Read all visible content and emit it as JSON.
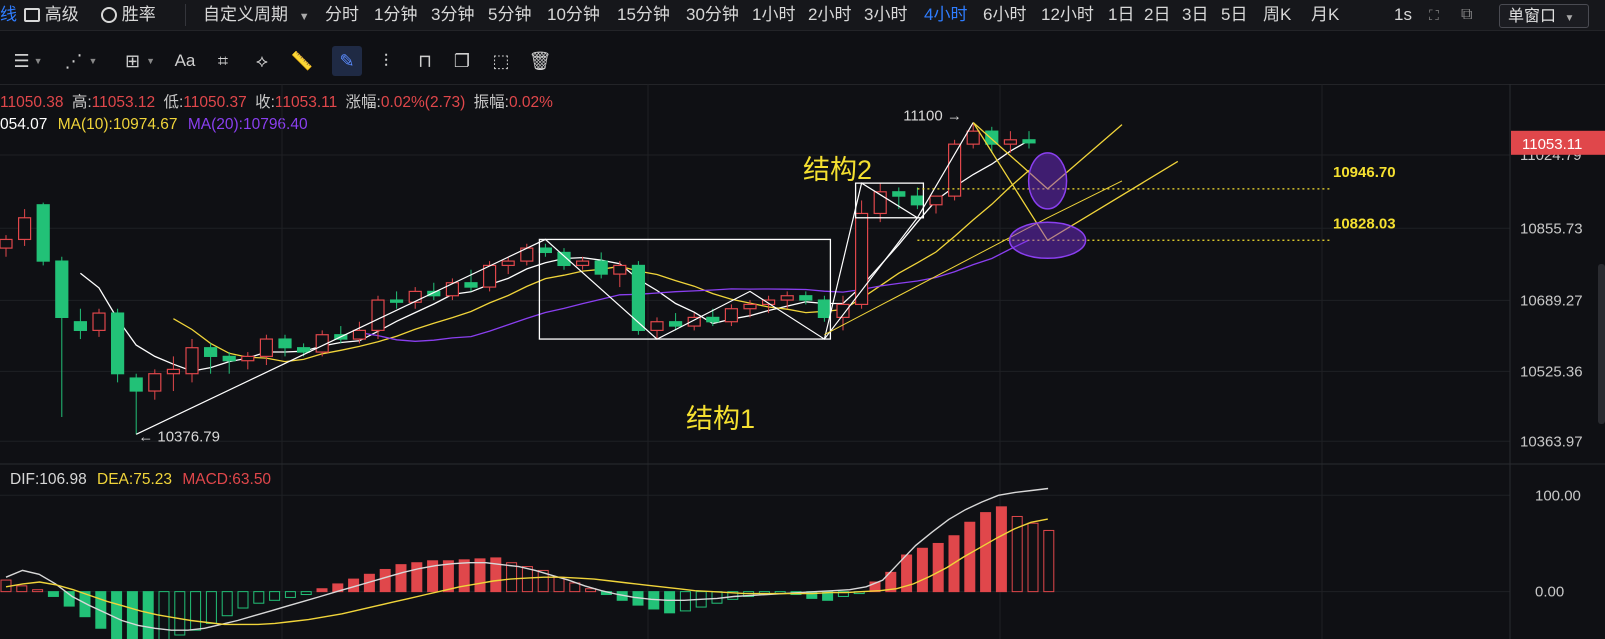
{
  "topbar": {
    "first_label": "线",
    "advanced": "高级",
    "win_rate": "胜率",
    "custom_period": "自定义周期",
    "periods": [
      "分时",
      "1分钟",
      "3分钟",
      "5分钟",
      "10分钟",
      "15分钟",
      "30分钟",
      "1小时",
      "2小时",
      "3小时",
      "4小时",
      "6小时",
      "12小时",
      "1日",
      "2日",
      "3日",
      "5日",
      "周K",
      "月K"
    ],
    "active_period": "4小时",
    "refresh": "1s",
    "window_mode": "单窗口"
  },
  "info": {
    "open": "11050.38",
    "high_label": "高:",
    "high": "11053.12",
    "low_label": "低:",
    "low": "11050.37",
    "close_label": "收:",
    "close": "11053.11",
    "change_label": "涨幅:",
    "change": "0.02%(2.73)",
    "amp_label": "振幅:",
    "amp": "0.02%",
    "ma5": "054.07",
    "ma10_label": "MA(10):",
    "ma10": "10974.67",
    "ma20_label": "MA(20):",
    "ma20": "10796.40"
  },
  "macd_info": {
    "dif_label": "DIF:",
    "dif": "106.98",
    "dea_label": "DEA:",
    "dea": "75.23",
    "macd_label": "MACD:",
    "macd": "63.50"
  },
  "colors": {
    "up": "#e0474b",
    "down": "#22c177",
    "ma5": "#ffffff",
    "ma10": "#f0d43a",
    "ma20": "#8a3ff0",
    "accent": "#2f7dff",
    "level": "#f5e030"
  },
  "chart_data": [
    {
      "type": "candlestick",
      "title": "",
      "ylim": [
        10330,
        11175
      ],
      "price_axis_ticks": [
        11024.79,
        10855.73,
        10689.27,
        10525.36,
        10363.97
      ],
      "current_price": "11053.11",
      "levels": [
        {
          "label": "10946.70",
          "value": 10946.7
        },
        {
          "label": "10828.03",
          "value": 10828.03
        }
      ],
      "annotations": [
        {
          "text": "结构1"
        },
        {
          "text": "结构2"
        },
        {
          "text": "← 10376.79",
          "value": 10376.79
        },
        {
          "text": "11100 →",
          "value": 11100
        }
      ],
      "candles": [
        {
          "o": 10810,
          "h": 10840,
          "l": 10790,
          "c": 10830
        },
        {
          "o": 10830,
          "h": 10900,
          "l": 10815,
          "c": 10880
        },
        {
          "o": 10910,
          "h": 10915,
          "l": 10770,
          "c": 10780
        },
        {
          "o": 10780,
          "h": 10790,
          "l": 10420,
          "c": 10650
        },
        {
          "o": 10640,
          "h": 10670,
          "l": 10600,
          "c": 10620
        },
        {
          "o": 10620,
          "h": 10670,
          "l": 10605,
          "c": 10660
        },
        {
          "o": 10660,
          "h": 10670,
          "l": 10500,
          "c": 10520
        },
        {
          "o": 10510,
          "h": 10520,
          "l": 10380,
          "c": 10480
        },
        {
          "o": 10480,
          "h": 10530,
          "l": 10460,
          "c": 10520
        },
        {
          "o": 10520,
          "h": 10560,
          "l": 10480,
          "c": 10530
        },
        {
          "o": 10520,
          "h": 10600,
          "l": 10500,
          "c": 10580
        },
        {
          "o": 10580,
          "h": 10590,
          "l": 10520,
          "c": 10560
        },
        {
          "o": 10560,
          "h": 10570,
          "l": 10520,
          "c": 10550
        },
        {
          "o": 10550,
          "h": 10570,
          "l": 10530,
          "c": 10560
        },
        {
          "o": 10560,
          "h": 10610,
          "l": 10540,
          "c": 10600
        },
        {
          "o": 10600,
          "h": 10610,
          "l": 10560,
          "c": 10580
        },
        {
          "o": 10580,
          "h": 10590,
          "l": 10560,
          "c": 10570
        },
        {
          "o": 10570,
          "h": 10620,
          "l": 10560,
          "c": 10610
        },
        {
          "o": 10610,
          "h": 10630,
          "l": 10590,
          "c": 10600
        },
        {
          "o": 10600,
          "h": 10640,
          "l": 10590,
          "c": 10620
        },
        {
          "o": 10620,
          "h": 10700,
          "l": 10600,
          "c": 10690
        },
        {
          "o": 10690,
          "h": 10710,
          "l": 10670,
          "c": 10685
        },
        {
          "o": 10685,
          "h": 10720,
          "l": 10670,
          "c": 10710
        },
        {
          "o": 10710,
          "h": 10730,
          "l": 10690,
          "c": 10700
        },
        {
          "o": 10700,
          "h": 10740,
          "l": 10690,
          "c": 10730
        },
        {
          "o": 10730,
          "h": 10760,
          "l": 10710,
          "c": 10720
        },
        {
          "o": 10720,
          "h": 10780,
          "l": 10710,
          "c": 10770
        },
        {
          "o": 10770,
          "h": 10790,
          "l": 10750,
          "c": 10780
        },
        {
          "o": 10780,
          "h": 10820,
          "l": 10770,
          "c": 10810
        },
        {
          "o": 10810,
          "h": 10820,
          "l": 10790,
          "c": 10800
        },
        {
          "o": 10800,
          "h": 10810,
          "l": 10760,
          "c": 10770
        },
        {
          "o": 10770,
          "h": 10790,
          "l": 10760,
          "c": 10780
        },
        {
          "o": 10780,
          "h": 10800,
          "l": 10740,
          "c": 10750
        },
        {
          "o": 10750,
          "h": 10780,
          "l": 10720,
          "c": 10770
        },
        {
          "o": 10770,
          "h": 10780,
          "l": 10610,
          "c": 10620
        },
        {
          "o": 10620,
          "h": 10650,
          "l": 10600,
          "c": 10640
        },
        {
          "o": 10640,
          "h": 10660,
          "l": 10620,
          "c": 10630
        },
        {
          "o": 10630,
          "h": 10660,
          "l": 10620,
          "c": 10650
        },
        {
          "o": 10650,
          "h": 10670,
          "l": 10630,
          "c": 10640
        },
        {
          "o": 10640,
          "h": 10680,
          "l": 10630,
          "c": 10670
        },
        {
          "o": 10670,
          "h": 10690,
          "l": 10650,
          "c": 10680
        },
        {
          "o": 10680,
          "h": 10700,
          "l": 10660,
          "c": 10690
        },
        {
          "o": 10690,
          "h": 10710,
          "l": 10670,
          "c": 10700
        },
        {
          "o": 10700,
          "h": 10710,
          "l": 10680,
          "c": 10690
        },
        {
          "o": 10690,
          "h": 10700,
          "l": 10640,
          "c": 10650
        },
        {
          "o": 10650,
          "h": 10700,
          "l": 10620,
          "c": 10680
        },
        {
          "o": 10680,
          "h": 10920,
          "l": 10670,
          "c": 10890
        },
        {
          "o": 10890,
          "h": 10960,
          "l": 10870,
          "c": 10940
        },
        {
          "o": 10940,
          "h": 10950,
          "l": 10900,
          "c": 10930
        },
        {
          "o": 10930,
          "h": 10950,
          "l": 10900,
          "c": 10910
        },
        {
          "o": 10910,
          "h": 10930,
          "l": 10890,
          "c": 10930
        },
        {
          "o": 10930,
          "h": 11060,
          "l": 10920,
          "c": 11050
        },
        {
          "o": 11050,
          "h": 11100,
          "l": 11040,
          "c": 11080
        },
        {
          "o": 11080,
          "h": 11090,
          "l": 11030,
          "c": 11050
        },
        {
          "o": 11050,
          "h": 11080,
          "l": 11030,
          "c": 11060
        },
        {
          "o": 11060,
          "h": 11080,
          "l": 11040,
          "c": 11053
        }
      ]
    },
    {
      "type": "bar",
      "title": "MACD",
      "ylim": [
        -45,
        120
      ],
      "axis_ticks": [
        "100.00",
        "0.00"
      ],
      "hist": [
        12,
        6,
        2,
        -5,
        -15,
        -26,
        -38,
        -52,
        -55,
        -58,
        -50,
        -45,
        -40,
        -33,
        -25,
        -17,
        -12,
        -9,
        -6,
        -3,
        3,
        8,
        13,
        18,
        23,
        28,
        30,
        32,
        32,
        33,
        34,
        35,
        30,
        26,
        22,
        15,
        9,
        3,
        -3,
        -9,
        -14,
        -18,
        -22,
        -20,
        -16,
        -12,
        -8,
        -5,
        -3,
        -2,
        -3,
        -7,
        -9,
        -5,
        -2,
        10,
        20,
        38,
        45,
        50,
        58,
        72,
        82,
        88,
        78,
        71,
        63.5
      ],
      "dif": [
        15,
        22,
        18,
        8,
        -5,
        -14,
        -22,
        -30,
        -35,
        -38,
        -40,
        -40,
        -38,
        -34,
        -30,
        -25,
        -20,
        -15,
        -10,
        -5,
        0,
        5,
        10,
        15,
        20,
        24,
        27,
        29,
        30,
        30,
        28,
        26,
        22,
        17,
        12,
        6,
        1,
        -3,
        -6,
        -8,
        -9,
        -9,
        -8,
        -7,
        -5,
        -4,
        -3,
        -2,
        -1,
        0,
        1,
        2,
        5,
        12,
        30,
        48,
        62,
        75,
        85,
        93,
        100,
        103,
        105,
        106.98
      ],
      "dea": [
        5,
        8,
        10,
        7,
        2,
        -4,
        -10,
        -15,
        -20,
        -24,
        -27,
        -30,
        -32,
        -34,
        -34,
        -34,
        -33,
        -31,
        -29,
        -26,
        -23,
        -19,
        -15,
        -11,
        -7,
        -3,
        1,
        5,
        8,
        11,
        13,
        14,
        15,
        15,
        14,
        13,
        11,
        9,
        7,
        5,
        3,
        1,
        0,
        -1,
        -2,
        -2,
        -2,
        -2,
        -2,
        -1,
        -1,
        0,
        1,
        3,
        8,
        16,
        25,
        36,
        46,
        56,
        65,
        72,
        75.23
      ]
    }
  ]
}
